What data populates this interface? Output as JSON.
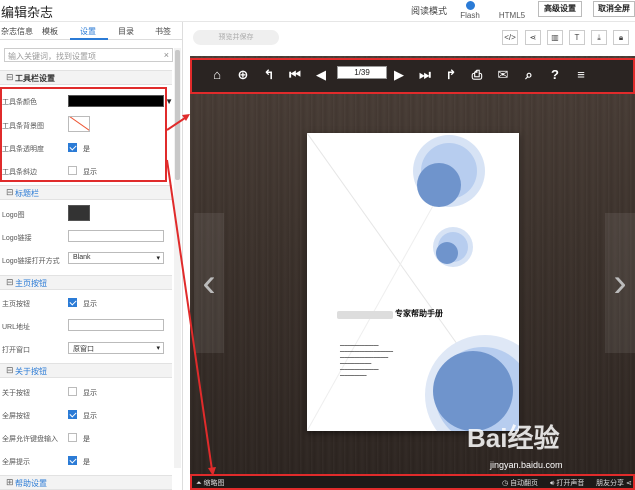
{
  "app": {
    "title": "编辑杂志"
  },
  "mode": {
    "label": "阅读模式",
    "options": [
      "Flash",
      "HTML5"
    ],
    "selected": "Flash"
  },
  "header_buttons": {
    "advanced": "高级设置",
    "exit_fullscreen": "取消全屏"
  },
  "tabs": [
    "杂志信息",
    "模板",
    "设置",
    "目录",
    "书签"
  ],
  "active_tab": "设置",
  "search": {
    "placeholder": "输入关键词，找到设置项",
    "clear": "×"
  },
  "sections": {
    "toolbar": {
      "title": "工具栏设置",
      "sign": "⊟",
      "rows": {
        "color": "工具条颜色",
        "bg": "工具条背景图",
        "transparency": "工具条透明度",
        "fold": "工具条斜边"
      },
      "transparency_value": "是",
      "fold_value": "显示"
    },
    "titlebar": {
      "title": "标题栏",
      "sign": "⊟",
      "rows": {
        "logo": "Logo图",
        "logo_link": "Logo链接",
        "logo_open": "Logo链接打开方式"
      },
      "logo_open_value": "Blank"
    },
    "home": {
      "title": "主页按钮",
      "sign": "⊟",
      "rows": {
        "home_btn": "主页按钮",
        "url": "URL地址",
        "open": "打开窗口"
      },
      "home_btn_value": "显示",
      "open_value": "原窗口"
    },
    "about": {
      "title": "关于按钮",
      "sign": "⊟",
      "rows": {
        "about_btn": "关于按钮",
        "fullscreen": "全屏按钮",
        "kbd": "全屏允许键盘输入",
        "tip": "全屏提示"
      },
      "about_value": "显示",
      "fullscreen_value": "显示",
      "kbd_value": "是",
      "tip_value": "是"
    },
    "help": {
      "title": "帮助设置",
      "sign": "⊞"
    }
  },
  "preview_button": "预览并保存",
  "tool_icons": [
    "code-icon",
    "share-icon",
    "frame-icon",
    "text-icon",
    "download-icon",
    "lock-icon"
  ],
  "reader": {
    "page": "1/39"
  },
  "book": {
    "title": "专家帮助手册"
  },
  "bottom_bar": {
    "thumbnails": "缩略图",
    "autoflip": "自动翻页",
    "sound": "打开声音",
    "share": "朋友分享"
  },
  "watermark": {
    "text": "Bai经验",
    "url": "jingyan.baidu.com"
  }
}
